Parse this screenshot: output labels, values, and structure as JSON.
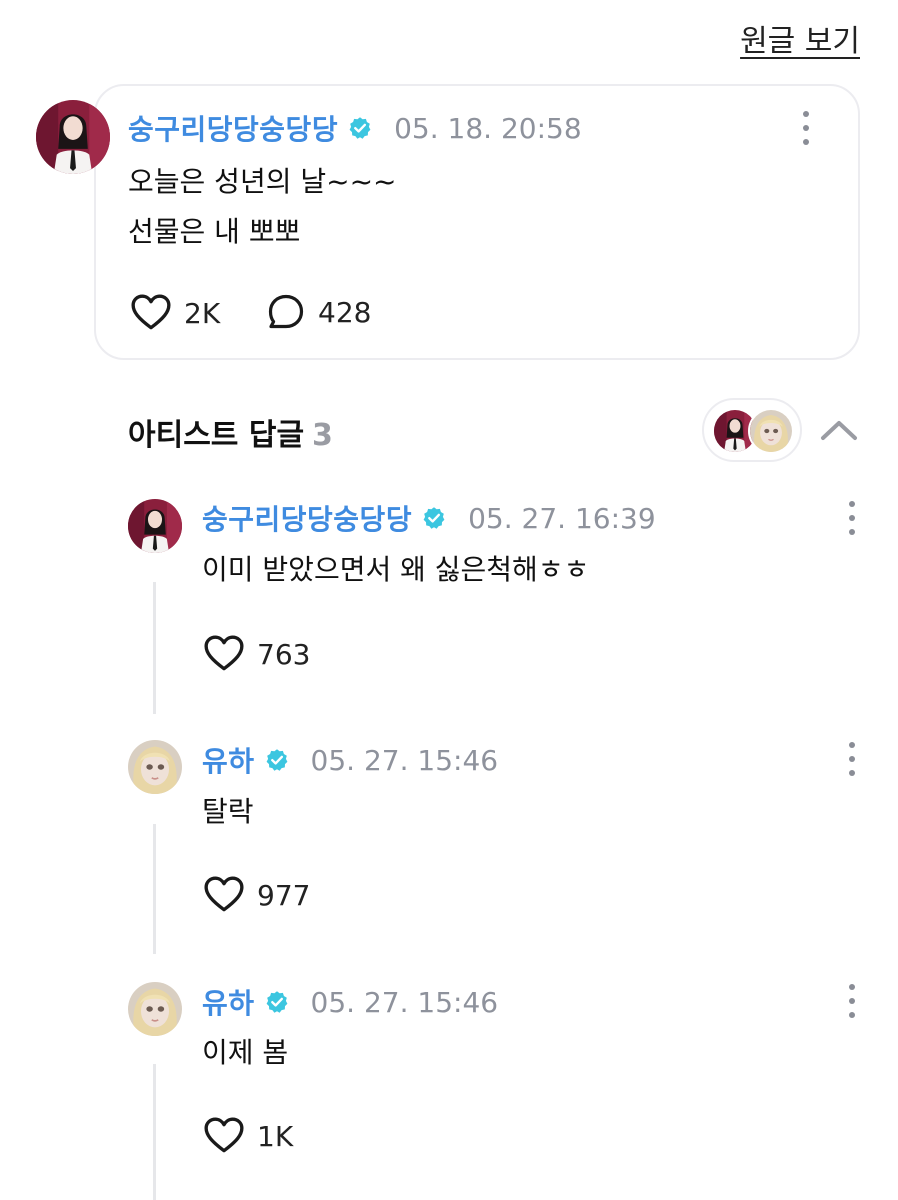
{
  "header": {
    "view_original": "원글 보기"
  },
  "post": {
    "author": "숭구리당당숭당당",
    "time": "05. 18. 20:58",
    "text": "오늘은 성년의 날~~~\n선물은 내 뽀뽀",
    "likes": "2K",
    "comments": "428"
  },
  "replies_section": {
    "title": "아티스트 답글",
    "count": "3"
  },
  "replies": [
    {
      "author": "숭구리당당숭당당",
      "time": "05. 27. 16:39",
      "text": "이미 받았으면서 왜 싫은척해ㅎㅎ",
      "likes": "763"
    },
    {
      "author": "유하",
      "time": "05. 27. 15:46",
      "text": "탈락",
      "likes": "977"
    },
    {
      "author": "유하",
      "time": "05. 27. 15:46",
      "text": "이제 봄",
      "likes": "1K"
    }
  ],
  "colors": {
    "author": "#3f8be0",
    "verified": "#3cc6e0",
    "meta": "#8e929c",
    "border": "#ececf0"
  },
  "icons": [
    "verified-badge-icon",
    "heart-icon",
    "comment-bubble-icon",
    "more-vertical-icon",
    "chevron-up-icon"
  ]
}
